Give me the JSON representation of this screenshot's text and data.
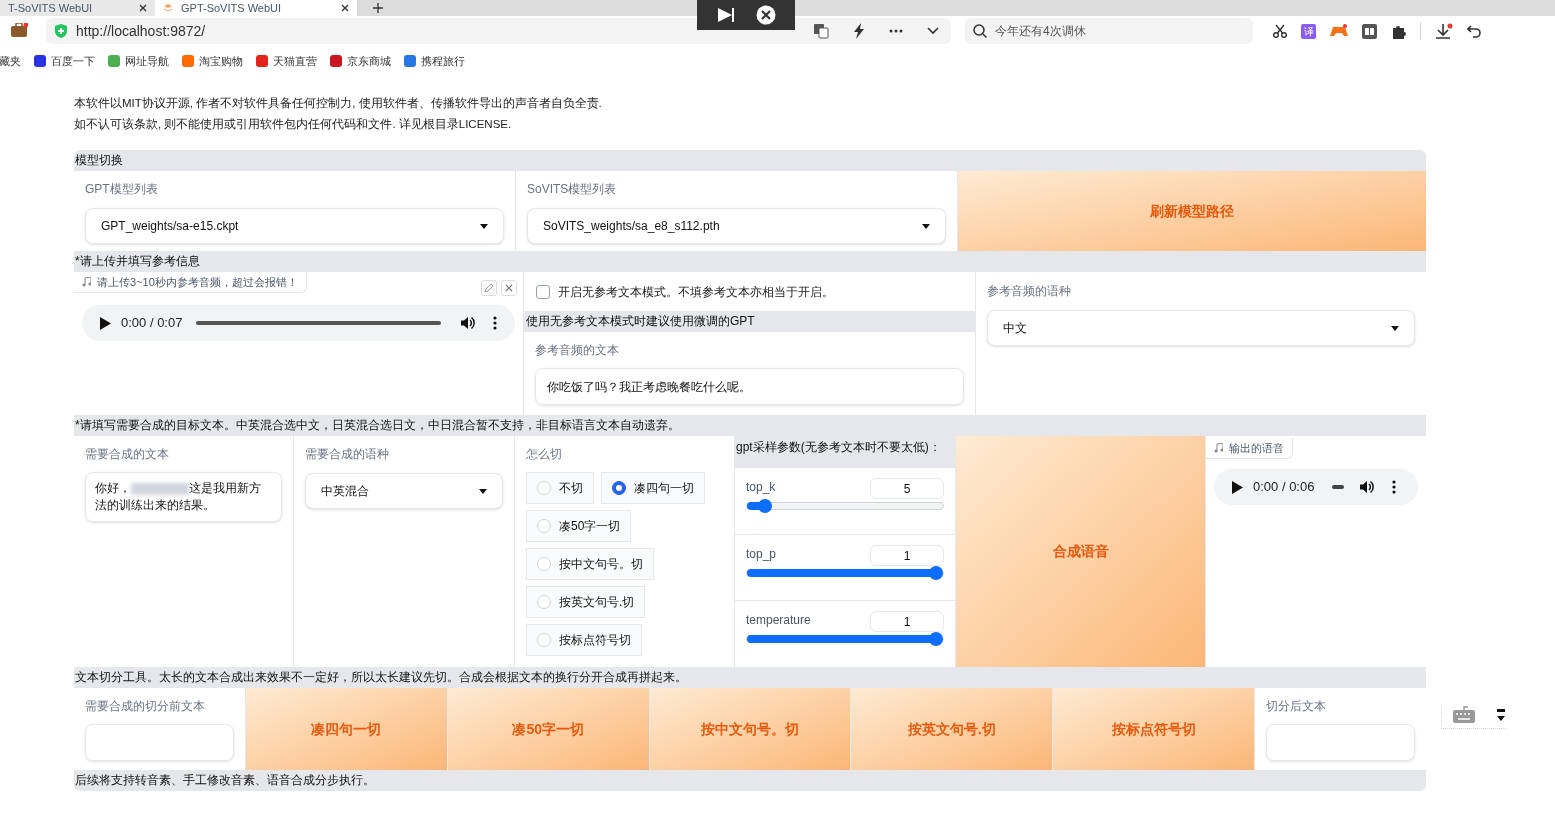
{
  "browser": {
    "tabs": [
      {
        "title": "T-SoVITS WebUI",
        "selected": false
      },
      {
        "title": "GPT-SoVITS WebUI",
        "selected": true
      }
    ],
    "address": "http://localhost:9872/",
    "search_placeholder": "今年还有4次调休",
    "translate_badge": "译",
    "bookmarks": [
      {
        "label": "藏夹",
        "color": "#ffffff"
      },
      {
        "label": "百度一下",
        "color": "#2932e1"
      },
      {
        "label": "网址导航",
        "color": "#4caf50"
      },
      {
        "label": "淘宝购物",
        "color": "#ff6a00"
      },
      {
        "label": "天猫直营",
        "color": "#e1251b"
      },
      {
        "label": "京东商城",
        "color": "#c81623"
      },
      {
        "label": "携程旅行",
        "color": "#2577e3"
      }
    ]
  },
  "notice": [
    "本软件以MIT协议开源, 作者不对软件具备任何控制力, 使用软件者、传播软件导出的声音者自负全责.",
    "如不认可该条款, 则不能使用或引用软件包内任何代码和文件. 详见根目录LICENSE."
  ],
  "model_section": {
    "title": "模型切换",
    "gpt_model": {
      "label": "GPT模型列表",
      "value": "GPT_weights/sa-e15.ckpt"
    },
    "sovits_model": {
      "label": "SoVITS模型列表",
      "value": "SoVITS_weights/sa_e8_s112.pth"
    },
    "refresh_button": "刷新模型路径"
  },
  "reference_section": {
    "title": "*请上传并填写参考信息",
    "audio": {
      "label": "请上传3~10秒内参考音频，超过会报错！",
      "time": "0:00 / 0:07"
    },
    "no_ref_mode": {
      "label": "开启无参考文本模式。不填参考文本亦相当于开启。",
      "checked": false
    },
    "hint": "使用无参考文本模式时建议使用微调的GPT",
    "ref_text": {
      "label": "参考音频的文本",
      "value": "你吃饭了吗？我正考虑晚餐吃什么呢。"
    },
    "ref_language": {
      "label": "参考音频的语种",
      "value": "中文"
    }
  },
  "synthesis_section": {
    "title": "*请填写需要合成的目标文本。中英混合选中文，日英混合选日文，中日混合暂不支持，非目标语言文本自动遗弃。",
    "target_text": {
      "label": "需要合成的文本",
      "value_start": "你好，",
      "value_end": "这是我用新方法的训练出来的结果。"
    },
    "target_language": {
      "label": "需要合成的语种",
      "value": "中英混合"
    },
    "cut_method": {
      "label": "怎么切",
      "options": [
        {
          "label": "不切",
          "selected": false
        },
        {
          "label": "凑四句一切",
          "selected": true
        },
        {
          "label": "凑50字一切",
          "selected": false
        },
        {
          "label": "按中文句号。切",
          "selected": false
        },
        {
          "label": "按英文句号.切",
          "selected": false
        },
        {
          "label": "按标点符号切",
          "selected": false
        }
      ]
    },
    "gpt_params": {
      "title": "gpt采样参数(无参考文本时不要太低)：",
      "sliders": [
        {
          "name": "top_k",
          "value": "5",
          "level": 0.06
        },
        {
          "name": "top_p",
          "value": "1",
          "level": 1
        },
        {
          "name": "temperature",
          "value": "1",
          "level": 1
        }
      ]
    },
    "synthesize_button": "合成语音",
    "output_audio": {
      "label": "输出的语音",
      "time": "0:00 / 0:06"
    }
  },
  "split_section": {
    "title": "文本切分工具。太长的文本合成出来效果不一定好，所以太长建议先切。合成会根据文本的换行分开合成再拼起来。",
    "input_label": "需要合成的切分前文本",
    "buttons": [
      "凑四句一切",
      "凑50字一切",
      "按中文句号。切",
      "按英文句号.切",
      "按标点符号切"
    ],
    "output_label": "切分后文本"
  },
  "footer": "后续将支持转音素、手工修改音素、语音合成分步执行。"
}
